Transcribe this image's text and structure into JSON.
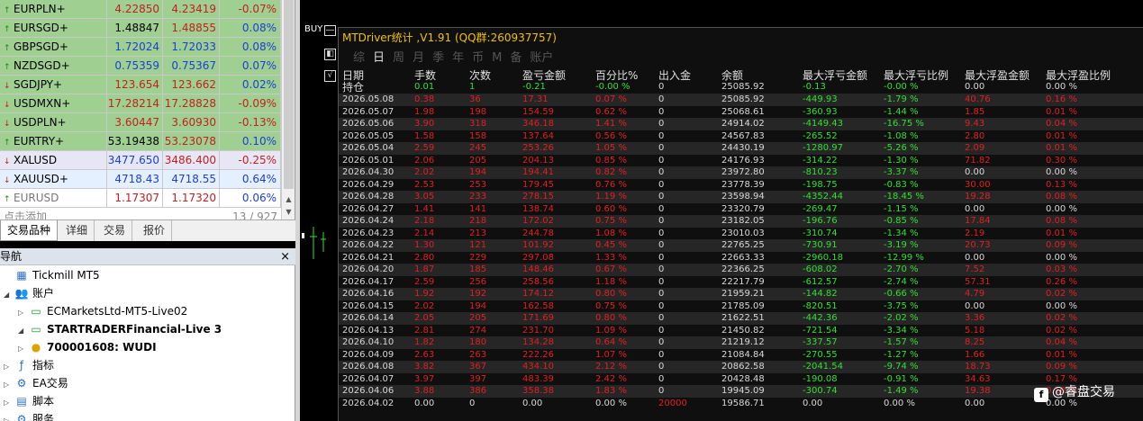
{
  "market_watch": {
    "rows": [
      {
        "symbol": "EURPLN+",
        "bid": "4.22850",
        "ask": "4.23419",
        "change": "-0.07%",
        "dir": "up",
        "bg": "#9fcf91",
        "bid_color": "#c42020",
        "ask_color": "#c42020",
        "chg_color": "#c42020"
      },
      {
        "symbol": "EURSGD+",
        "bid": "1.48847",
        "ask": "1.48855",
        "change": "0.08%",
        "dir": "up",
        "bg": "#9fcf91",
        "bid_color": "#000000",
        "ask_color": "#c42020",
        "chg_color": "#1c3fd6"
      },
      {
        "symbol": "GBPSGD+",
        "bid": "1.72024",
        "ask": "1.72033",
        "change": "0.08%",
        "dir": "up",
        "bg": "#9fcf91",
        "bid_color": "#1c3fd6",
        "ask_color": "#1c3fd6",
        "chg_color": "#1c3fd6"
      },
      {
        "symbol": "NZDSGD+",
        "bid": "0.75359",
        "ask": "0.75367",
        "change": "0.07%",
        "dir": "up",
        "bg": "#9fcf91",
        "bid_color": "#1c3fd6",
        "ask_color": "#1c3fd6",
        "chg_color": "#1c3fd6"
      },
      {
        "symbol": "SGDJPY+",
        "bid": "123.654",
        "ask": "123.662",
        "change": "0.02%",
        "dir": "dn",
        "bg": "#9fcf91",
        "bid_color": "#c42020",
        "ask_color": "#c42020",
        "chg_color": "#1c3fd6"
      },
      {
        "symbol": "USDMXN+",
        "bid": "17.28214",
        "ask": "17.28828",
        "change": "-0.09%",
        "dir": "dn",
        "bg": "#9fcf91",
        "bid_color": "#c42020",
        "ask_color": "#c42020",
        "chg_color": "#c42020"
      },
      {
        "symbol": "USDPLN+",
        "bid": "3.60447",
        "ask": "3.60930",
        "change": "-0.13%",
        "dir": "dn",
        "bg": "#9fcf91",
        "bid_color": "#c42020",
        "ask_color": "#c42020",
        "chg_color": "#c42020"
      },
      {
        "symbol": "EURTRY+",
        "bid": "53.19438",
        "ask": "53.23078",
        "change": "0.10%",
        "dir": "up",
        "bg": "#9fcf91",
        "bid_color": "#000000",
        "ask_color": "#c42020",
        "chg_color": "#1c3fd6"
      },
      {
        "symbol": "XALUSD",
        "bid": "3477.650",
        "ask": "3486.400",
        "change": "-0.25%",
        "dir": "dn",
        "bg": "#e6e6f5",
        "bid_color": "#1c3fd6",
        "ask_color": "#c42020",
        "chg_color": "#c42020"
      },
      {
        "symbol": "XAUUSD+",
        "bid": "4718.43",
        "ask": "4718.55",
        "change": "0.64%",
        "dir": "dn",
        "bg": "#e4f0ff",
        "bid_color": "#1c3fd6",
        "ask_color": "#1c3fd6",
        "chg_color": "#1c3fd6"
      },
      {
        "symbol": "EURUSD",
        "bid": "1.17307",
        "ask": "1.17320",
        "change": "0.06%",
        "dir": "up",
        "bg": "#ffffff",
        "bid_color": "#c42020",
        "ask_color": "#c42020",
        "chg_color": "#1c3fd6",
        "sym_color": "#777777"
      }
    ],
    "footer_left": "点击添加",
    "footer_right": "13 / 927"
  },
  "tabs": [
    "交易品种",
    "详细",
    "交易",
    "报价"
  ],
  "navigator": {
    "title": "导航",
    "close": "×",
    "items": [
      {
        "label": "Tickmill MT5",
        "icon": "broker-icon",
        "glyph": "▦",
        "level": 0,
        "toggle": "",
        "bold": false
      },
      {
        "label": "账户",
        "icon": "accounts-icon",
        "glyph": "👥",
        "level": 1,
        "toggle": "◢",
        "bold": false
      },
      {
        "label": "ECMarketsLtd-MT5-Live02",
        "icon": "server-icon",
        "glyph": "▭",
        "level": 2,
        "toggle": "▷",
        "bold": false
      },
      {
        "label": "STARTRADERFinancial-Live 3",
        "icon": "server-icon",
        "glyph": "▭",
        "level": 2,
        "toggle": "◢",
        "bold": true
      },
      {
        "label": "700001608: WUDI",
        "icon": "user-icon",
        "glyph": "●",
        "level": 3,
        "toggle": "▷",
        "bold": true
      },
      {
        "label": "指标",
        "icon": "indicators-icon",
        "glyph": "ƒ",
        "level": 1,
        "toggle": "▷",
        "bold": false
      },
      {
        "label": "EA交易",
        "icon": "expert-icon",
        "glyph": "⚙",
        "level": 1,
        "toggle": "▷",
        "bold": false
      },
      {
        "label": "脚本",
        "icon": "scripts-icon",
        "glyph": "▤",
        "level": 1,
        "toggle": "▷",
        "bold": false
      },
      {
        "label": "服务",
        "icon": "services-icon",
        "glyph": "⚙",
        "level": 1,
        "toggle": "▷",
        "bold": false
      }
    ]
  },
  "chart": {
    "buy_label": "BUY",
    "min_button": "—",
    "toggle_button": "◧",
    "check_button": "√"
  },
  "stats": {
    "title": "MTDriver统计 ,V1.91 (QQ群:260937757)",
    "periods": [
      {
        "label": "综",
        "selected": false
      },
      {
        "label": "日",
        "selected": true
      },
      {
        "label": "周",
        "selected": false
      },
      {
        "label": "月",
        "selected": false
      },
      {
        "label": "季",
        "selected": false
      },
      {
        "label": "年",
        "selected": false
      },
      {
        "label": "币",
        "selected": false
      },
      {
        "label": "M",
        "selected": false
      },
      {
        "label": "备",
        "selected": false
      },
      {
        "label": "账户",
        "selected": false
      }
    ],
    "headers": [
      "日期",
      "手数",
      "次数",
      "盈亏金额",
      "百分比%",
      "出入金",
      "余额",
      "最大浮亏金额",
      "最大浮亏比例",
      "最大浮盈金额",
      "最大浮盈比例"
    ],
    "holding": [
      "持仓",
      "0.01",
      "1",
      "-0.21",
      "-0.00 %",
      "0",
      "25085.92",
      "-0.13",
      "-0.00 %",
      "0.00",
      "0.00 %"
    ],
    "rows": [
      [
        "2026.05.08",
        "0.38",
        "36",
        "17.31",
        "0.07 %",
        "0",
        "25085.92",
        "-449.93",
        "-1.79 %",
        "40.76",
        "0.16 %"
      ],
      [
        "2026.05.07",
        "1.98",
        "198",
        "154.59",
        "0.62 %",
        "0",
        "25068.61",
        "-360.93",
        "-1.44 %",
        "1.85",
        "0.01 %"
      ],
      [
        "2026.05.06",
        "3.90",
        "318",
        "346.18",
        "1.41 %",
        "0",
        "24914.02",
        "-4149.43",
        "-16.75 %",
        "9.43",
        "0.04 %"
      ],
      [
        "2026.05.05",
        "1.58",
        "158",
        "137.64",
        "0.56 %",
        "0",
        "24567.83",
        "-265.52",
        "-1.08 %",
        "2.80",
        "0.01 %"
      ],
      [
        "2026.05.04",
        "2.59",
        "245",
        "253.26",
        "1.05 %",
        "0",
        "24430.19",
        "-1280.97",
        "-5.26 %",
        "2.09",
        "0.01 %"
      ],
      [
        "2026.05.01",
        "2.06",
        "205",
        "204.13",
        "0.85 %",
        "0",
        "24176.93",
        "-314.22",
        "-1.30 %",
        "71.82",
        "0.30 %"
      ],
      [
        "2026.04.30",
        "2.02",
        "194",
        "194.41",
        "0.82 %",
        "0",
        "23972.80",
        "-810.23",
        "-3.37 %",
        "0.00",
        "0.00 %"
      ],
      [
        "2026.04.29",
        "2.53",
        "253",
        "179.45",
        "0.76 %",
        "0",
        "23778.39",
        "-198.75",
        "-0.83 %",
        "30.00",
        "0.13 %"
      ],
      [
        "2026.04.28",
        "3.05",
        "233",
        "278.15",
        "1.19 %",
        "0",
        "23598.94",
        "-4352.44",
        "-18.45 %",
        "19.28",
        "0.08 %"
      ],
      [
        "2026.04.27",
        "1.41",
        "141",
        "138.74",
        "0.60 %",
        "0",
        "23320.79",
        "-269.47",
        "-1.15 %",
        "0.00",
        "0.00 %"
      ],
      [
        "2026.04.24",
        "2.18",
        "218",
        "172.02",
        "0.75 %",
        "0",
        "23182.05",
        "-196.76",
        "-0.85 %",
        "17.84",
        "0.08 %"
      ],
      [
        "2026.04.23",
        "2.14",
        "213",
        "244.78",
        "1.08 %",
        "0",
        "23010.03",
        "-310.74",
        "-1.34 %",
        "2.19",
        "0.01 %"
      ],
      [
        "2026.04.22",
        "1.30",
        "121",
        "101.92",
        "0.45 %",
        "0",
        "22765.25",
        "-730.91",
        "-3.19 %",
        "20.73",
        "0.09 %"
      ],
      [
        "2026.04.21",
        "2.80",
        "229",
        "297.08",
        "1.33 %",
        "0",
        "22663.33",
        "-2960.18",
        "-12.99 %",
        "0.00",
        "0.00 %"
      ],
      [
        "2026.04.20",
        "1.87",
        "185",
        "148.46",
        "0.67 %",
        "0",
        "22366.25",
        "-608.02",
        "-2.70 %",
        "7.52",
        "0.03 %"
      ],
      [
        "2026.04.17",
        "2.59",
        "256",
        "258.56",
        "1.18 %",
        "0",
        "22217.79",
        "-612.57",
        "-2.74 %",
        "57.31",
        "0.26 %"
      ],
      [
        "2026.04.16",
        "1.92",
        "192",
        "174.12",
        "0.80 %",
        "0",
        "21959.21",
        "-144.82",
        "-0.66 %",
        "4.79",
        "0.02 %"
      ],
      [
        "2026.04.15",
        "2.02",
        "194",
        "162.58",
        "0.75 %",
        "0",
        "21785.09",
        "-820.51",
        "-3.75 %",
        "0.00",
        "0.00 %"
      ],
      [
        "2026.04.14",
        "2.05",
        "205",
        "171.69",
        "0.80 %",
        "0",
        "21622.51",
        "-442.36",
        "-2.02 %",
        "3.36",
        "0.02 %"
      ],
      [
        "2026.04.13",
        "2.81",
        "274",
        "231.70",
        "1.09 %",
        "0",
        "21450.82",
        "-721.54",
        "-3.34 %",
        "5.18",
        "0.02 %"
      ],
      [
        "2026.04.10",
        "1.82",
        "180",
        "134.28",
        "0.64 %",
        "0",
        "21219.12",
        "-337.57",
        "-1.57 %",
        "8.25",
        "0.04 %"
      ],
      [
        "2026.04.09",
        "2.63",
        "263",
        "222.26",
        "1.07 %",
        "0",
        "21084.84",
        "-270.55",
        "-1.27 %",
        "1.66",
        "0.01 %"
      ],
      [
        "2026.04.08",
        "3.82",
        "367",
        "434.10",
        "2.12 %",
        "0",
        "20862.58",
        "-2041.54",
        "-9.74 %",
        "18.73",
        "0.09 %"
      ],
      [
        "2026.04.07",
        "3.97",
        "397",
        "483.39",
        "2.42 %",
        "0",
        "20428.48",
        "-190.08",
        "-0.91 %",
        "34.63",
        "0.17 %"
      ],
      [
        "2026.04.06",
        "3.88",
        "386",
        "358.38",
        "1.83 %",
        "0",
        "19945.09",
        "-300.74",
        "-1.49 %",
        "19.38",
        "0.10 %"
      ],
      [
        "2026.04.02",
        "0.00",
        "0",
        "0.00",
        "0.00 %",
        "20000",
        "19586.71",
        "0.00",
        "0.00 %",
        "0.00",
        "0.00 %"
      ]
    ]
  },
  "brand": {
    "icon": "f",
    "text": "@睿盘交易"
  }
}
